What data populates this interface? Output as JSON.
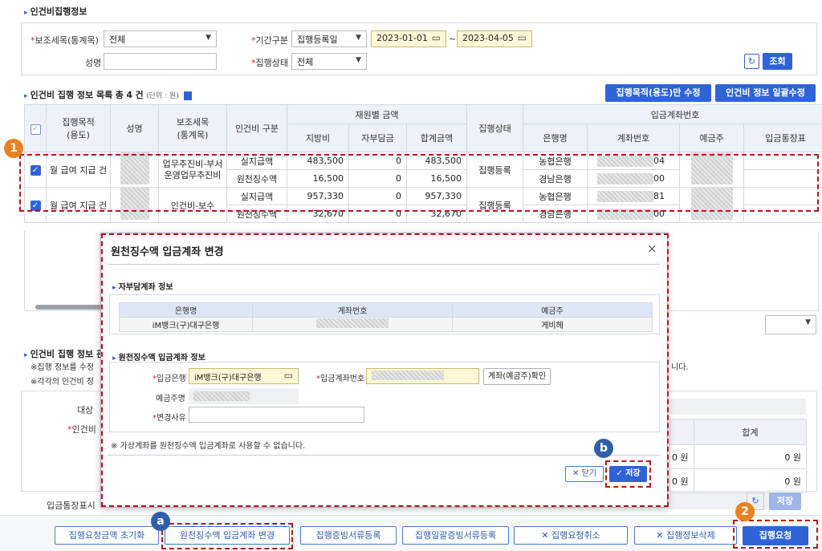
{
  "colors": {
    "accent": "#2f63d8",
    "header_bg": "#eef1f7",
    "highlight_dash": "#b3161b",
    "badge_orange": "#ea8120",
    "badge_blue": "#2f5fa8"
  },
  "page": {
    "section_title": "인건비집행정보"
  },
  "search": {
    "subitem_label": "보조세목(통계목)",
    "subitem_value": "전체",
    "period_label": "기간구분",
    "period_type": "집행등록일",
    "date_from": "2023-01-01",
    "date_sep": "~",
    "date_to": "2023-04-05",
    "name_label": "성명",
    "name_value": "",
    "status_label": "집행상태",
    "status_value": "전체",
    "search_button": "조회",
    "refresh_icon": "refresh-icon"
  },
  "list": {
    "title": "인건비 집행 정보 목록",
    "total_prefix": "총",
    "total_count": "4",
    "total_suffix": "건",
    "unit": "(단위 : 원)",
    "btn_edit_purpose": "집행목적(용도)만 수정",
    "btn_bulk_edit": "인건비 정보 일괄수정",
    "headers": {
      "purpose": "집행목적\n(용도)",
      "name": "성명",
      "subitem": "보조세목\n(통계목)",
      "type": "인건비 구분",
      "funding": "재원별 금액",
      "local": "지방비",
      "self": "자부담금",
      "total": "합계금액",
      "status": "집행상태",
      "account_group": "입금계좌번호",
      "bank": "은행명",
      "account": "계좌번호",
      "holder": "예금주",
      "bankbook": "입금통장표"
    },
    "rows": [
      {
        "purpose": "월 급여 지급 건",
        "subitem": "업무추진비-부서운영업무추진비",
        "status": "집행등록",
        "lines": [
          {
            "type": "실지급액",
            "local": "483,500",
            "self": "0",
            "total": "483,500",
            "bank": "농협은행",
            "acct_tail": "04",
            "holder": ""
          },
          {
            "type": "원천징수액",
            "local": "16,500",
            "self": "0",
            "total": "16,500",
            "bank": "경남은행",
            "acct_tail": "00",
            "holder": "사"
          }
        ]
      },
      {
        "purpose": "월 급여 지급 건",
        "subitem": "인건비-보수",
        "status": "집행등록",
        "lines": [
          {
            "type": "실지급액",
            "local": "957,330",
            "self": "0",
            "total": "957,330",
            "bank": "농협은행",
            "acct_tail": "81",
            "holder": ""
          },
          {
            "type": "원천징수액",
            "local": "32,670",
            "self": "0",
            "total": "32,670",
            "bank": "경남은행",
            "acct_tail": "00",
            "holder": "사"
          }
        ]
      }
    ]
  },
  "background_form": {
    "section_title": "인건비 집행 정보 관",
    "note1": "※집행 정보를 수정",
    "note2": "※각각의 인건비 정",
    "note_tail": "니다.",
    "label_target": "대상",
    "label_labor": "인건비",
    "sum_header": "합계",
    "sum_row1": "0 원",
    "sum_row2": "0 원",
    "row_mark1": "0",
    "row_unit1": "원",
    "row_mark2": "0",
    "row_unit2": "원",
    "label_bankbook": "입금통장표시",
    "save_small": "저장"
  },
  "modal": {
    "title": "원천징수액 입금계좌 변경",
    "close_icon": "close-icon",
    "self_section": "자부담계좌 정보",
    "self_headers": [
      "은행명",
      "계좌번호",
      "예금주"
    ],
    "self_row": {
      "bank": "iM뱅크(구)대구은행",
      "account": "",
      "holder": "게비헤"
    },
    "withhold_section": "원천징수액 입금계좌 정보",
    "bank_label": "입금은행",
    "bank_value": "iM뱅크(구)대구은행",
    "acct_label": "입금계좌번호",
    "acct_value": "",
    "check_button": "계좌(예금주)확인",
    "holder_label": "예금주명",
    "holder_value": "",
    "reason_label": "변경사유",
    "reason_value": "",
    "notice": "※ 가상계좌를 원천징수액 입금계좌로 사용할 수 없습니다.",
    "close_button": "닫기",
    "save_button": "저장"
  },
  "bottom_bar": {
    "btn_reset": "집행요청금액 초기화",
    "btn_change_account": "원천징수액 입금계좌 변경",
    "btn_doc_register": "집행증빙서류등록",
    "btn_bulk_doc": "집행일괄증빙서류등록",
    "btn_cancel_request": "집행요청취소",
    "btn_delete_info": "집행정보삭제",
    "btn_request": "집행요청"
  },
  "badges": {
    "step1": "1",
    "step2": "2",
    "step_a": "a",
    "step_b": "b"
  },
  "right_select": {
    "value": ""
  }
}
